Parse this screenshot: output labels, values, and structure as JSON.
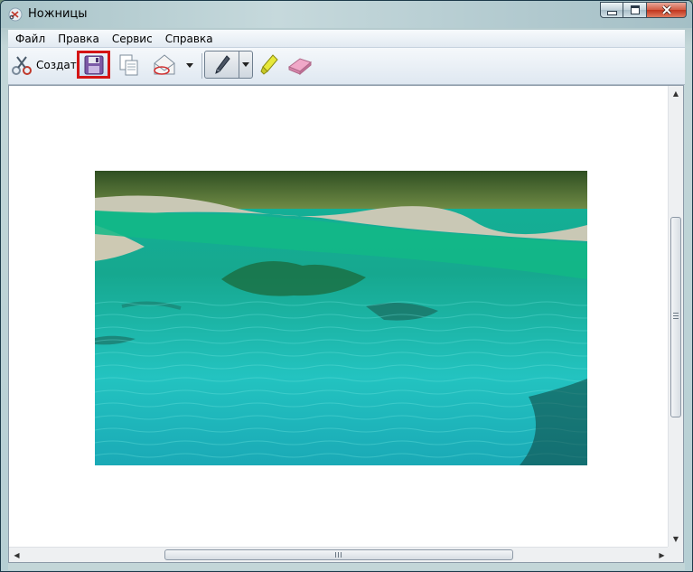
{
  "window": {
    "title": "Ножницы",
    "icon": "scissors-app-icon"
  },
  "menu": {
    "items": [
      "Файл",
      "Правка",
      "Сервис",
      "Справка"
    ]
  },
  "toolbar": {
    "new_label": "Создать",
    "new_icon": "scissors-icon",
    "save_icon": "floppy-disk-icon",
    "save_highlight_color": "#d41515",
    "copy_icon": "copy-icon",
    "send_icon": "envelope-icon",
    "pen_icon": "pen-icon",
    "highlighter_icon": "highlighter-icon",
    "eraser_icon": "eraser-icon"
  },
  "canvas": {
    "image_description_icon": "lake-photo"
  },
  "colors": {
    "water_dark": "#0c7a6a",
    "water_light": "#2fd3c3",
    "forest": "#3f5a2c"
  }
}
